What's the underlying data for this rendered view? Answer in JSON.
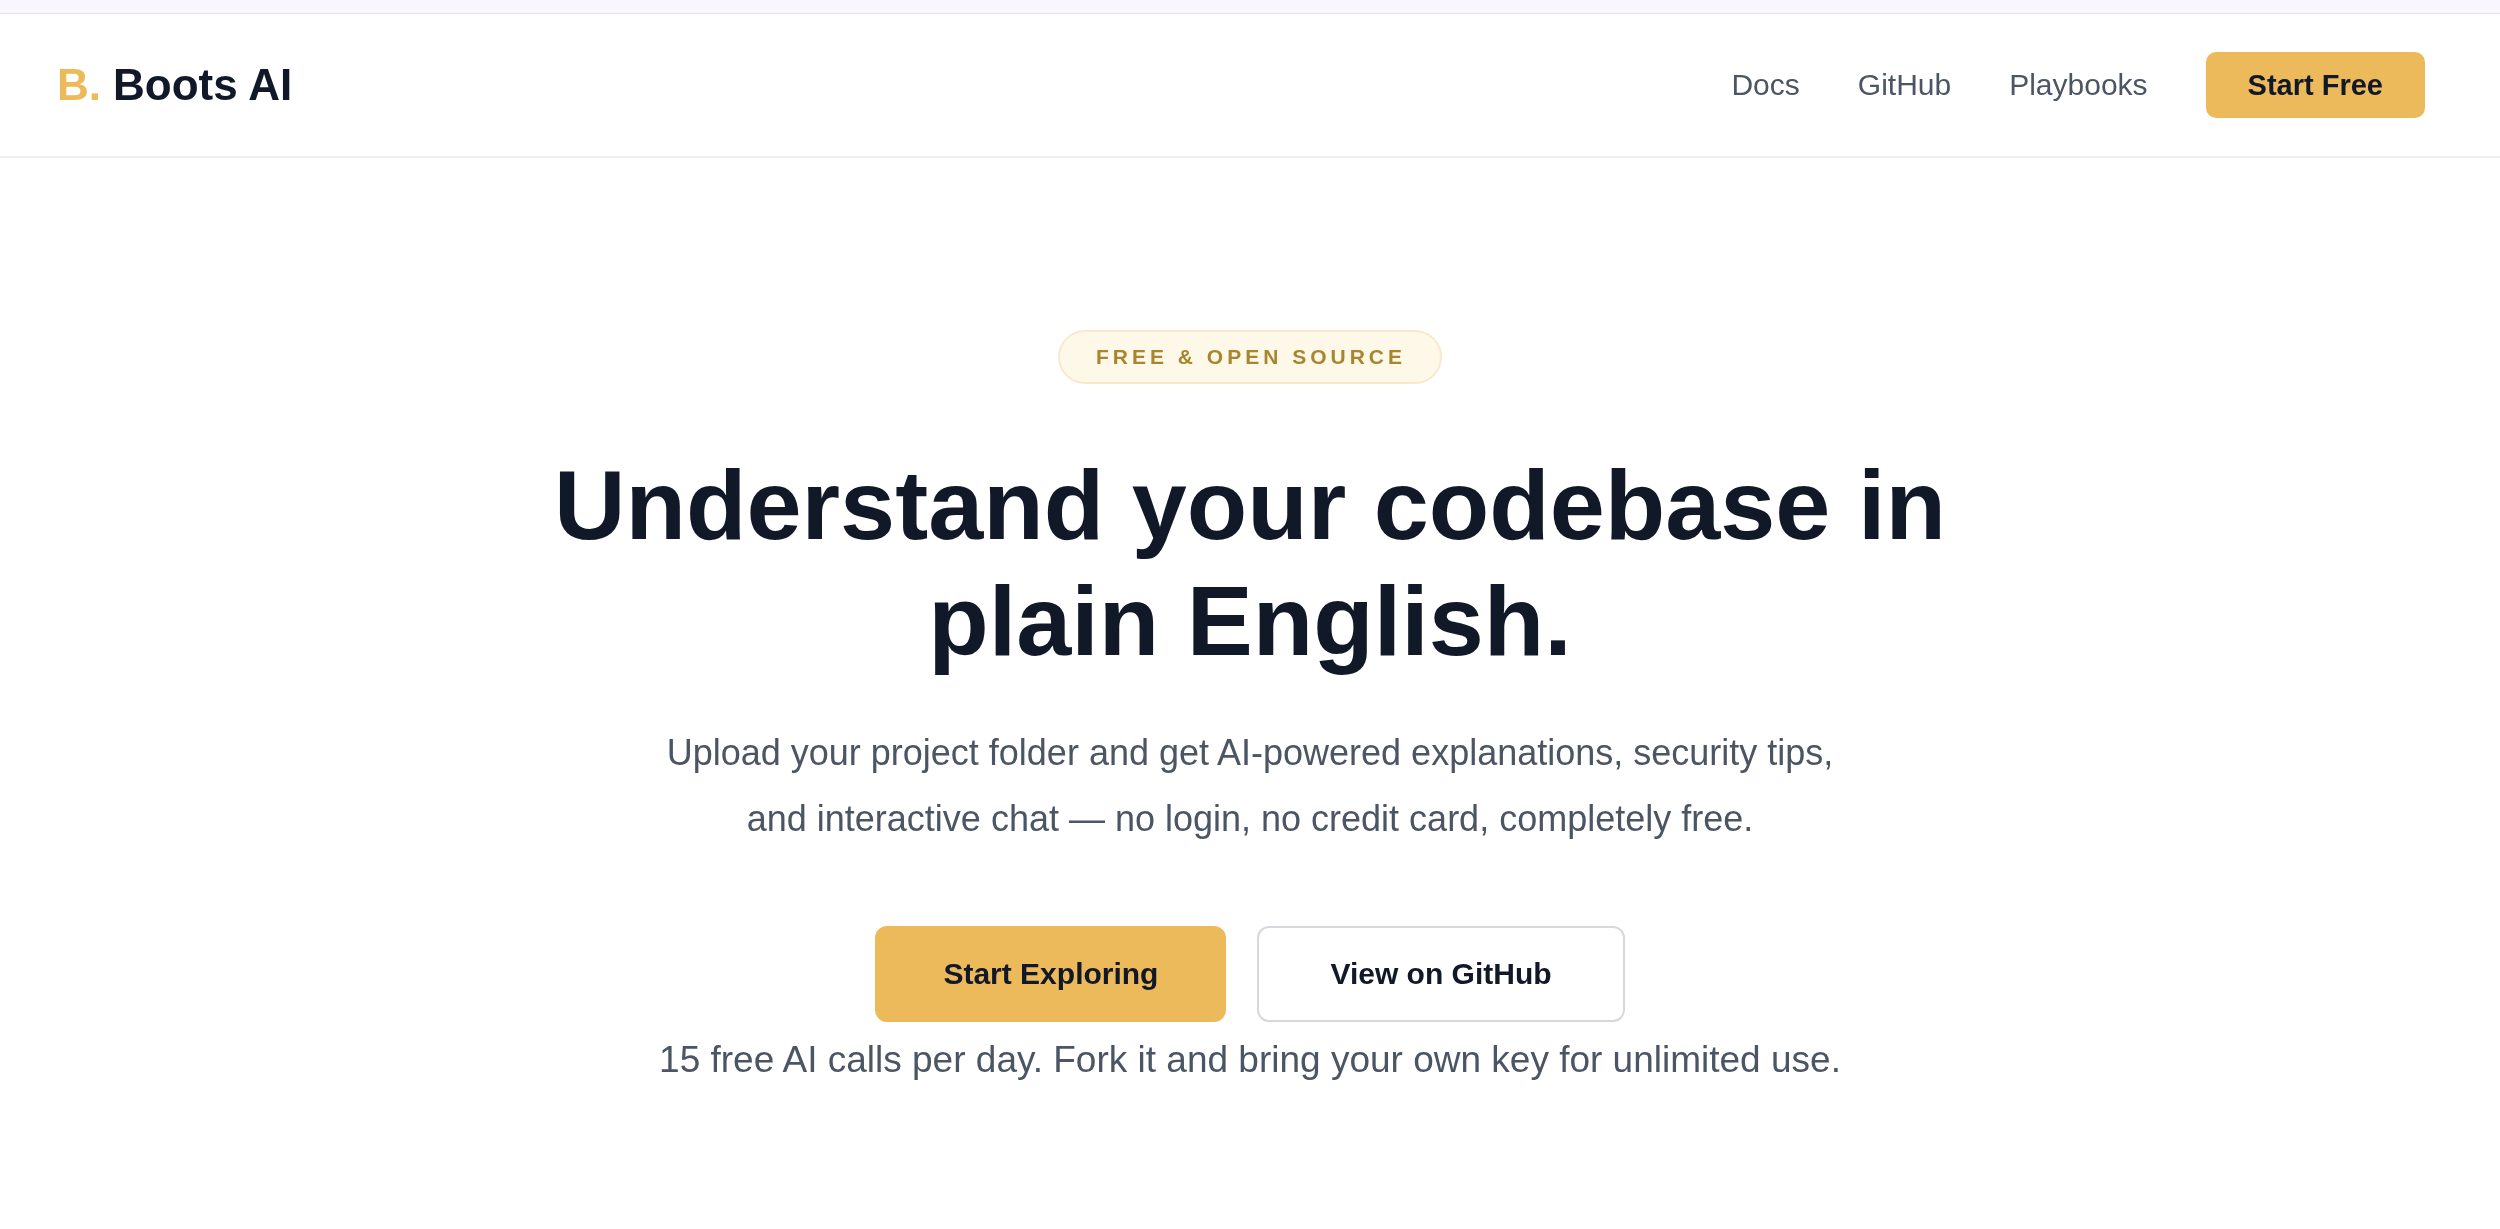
{
  "header": {
    "logo": {
      "mark": "B.",
      "name": "Boots AI"
    },
    "nav": [
      "Docs",
      "GitHub",
      "Playbooks"
    ],
    "cta": "Start Free"
  },
  "hero": {
    "badge": "FREE & OPEN SOURCE",
    "title": "Understand your codebase in plain English.",
    "subtitle": "Upload your project folder and get AI-powered explanations, security tips, and interactive chat — no login, no credit card, completely free.",
    "buttons": [
      {
        "label": "Start Exploring",
        "kind": "primary"
      },
      {
        "label": "View on GitHub",
        "kind": "secondary"
      }
    ],
    "note": "15 free AI calls per day. Fork it and bring your own key for unlimited use."
  }
}
